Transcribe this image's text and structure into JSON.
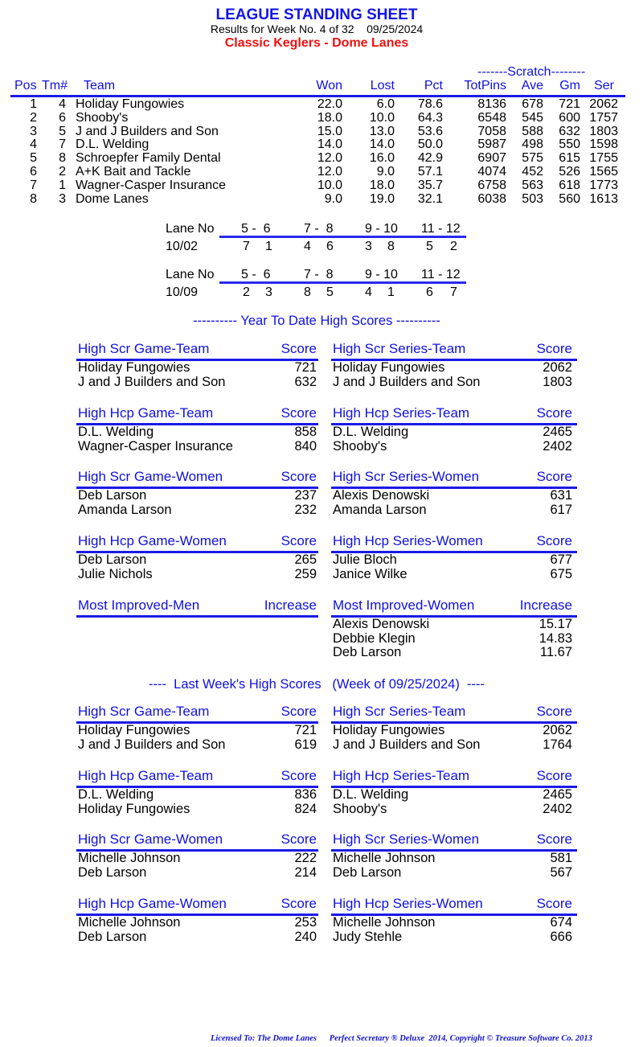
{
  "header": {
    "title": "LEAGUE STANDING SHEET",
    "subtitle": "Results for Week No. 4 of 32    09/25/2024",
    "league": "Classic Keglers - Dome Lanes"
  },
  "standings": {
    "group_label": "-------Scratch--------",
    "columns": [
      "Pos",
      "Tm#",
      "Team",
      "Won",
      "Lost",
      "Pct",
      "TotPins",
      "Ave",
      "Gm",
      "Ser"
    ],
    "rows": [
      {
        "pos": "1",
        "tm": "4",
        "team": "Holiday Fungowies",
        "won": "22.0",
        "lost": "6.0",
        "pct": "78.6",
        "totpins": "8136",
        "ave": "678",
        "gm": "721",
        "ser": "2062"
      },
      {
        "pos": "2",
        "tm": "6",
        "team": "Shooby's",
        "won": "18.0",
        "lost": "10.0",
        "pct": "64.3",
        "totpins": "6548",
        "ave": "545",
        "gm": "600",
        "ser": "1757"
      },
      {
        "pos": "3",
        "tm": "5",
        "team": "J and J Builders and Son",
        "won": "15.0",
        "lost": "13.0",
        "pct": "53.6",
        "totpins": "7058",
        "ave": "588",
        "gm": "632",
        "ser": "1803"
      },
      {
        "pos": "4",
        "tm": "7",
        "team": "D.L. Welding",
        "won": "14.0",
        "lost": "14.0",
        "pct": "50.0",
        "totpins": "5987",
        "ave": "498",
        "gm": "550",
        "ser": "1598"
      },
      {
        "pos": "5",
        "tm": "8",
        "team": "Schroepfer Family Dental",
        "won": "12.0",
        "lost": "16.0",
        "pct": "42.9",
        "totpins": "6907",
        "ave": "575",
        "gm": "615",
        "ser": "1755"
      },
      {
        "pos": "6",
        "tm": "2",
        "team": "A+K Bait and Tackle",
        "won": "12.0",
        "lost": "9.0",
        "pct": "57.1",
        "totpins": "4074",
        "ave": "452",
        "gm": "526",
        "ser": "1565"
      },
      {
        "pos": "7",
        "tm": "1",
        "team": "Wagner-Casper Insurance",
        "won": "10.0",
        "lost": "18.0",
        "pct": "35.7",
        "totpins": "6758",
        "ave": "563",
        "gm": "618",
        "ser": "1773"
      },
      {
        "pos": "8",
        "tm": "3",
        "team": "Dome Lanes",
        "won": "9.0",
        "lost": "19.0",
        "pct": "32.1",
        "totpins": "6038",
        "ave": "503",
        "gm": "560",
        "ser": "1613"
      }
    ]
  },
  "lane_assignments": [
    {
      "label": "Lane No",
      "lanes": [
        "5 -  6",
        "7 -  8",
        "9 - 10",
        "11 - 12"
      ],
      "date": "10/02",
      "pairs": [
        [
          "7",
          "1"
        ],
        [
          "4",
          "6"
        ],
        [
          "3",
          "8"
        ],
        [
          "5",
          "2"
        ]
      ]
    },
    {
      "label": "Lane No",
      "lanes": [
        "5 -  6",
        "7 -  8",
        "9 - 10",
        "11 - 12"
      ],
      "date": "10/09",
      "pairs": [
        [
          "2",
          "3"
        ],
        [
          "8",
          "5"
        ],
        [
          "4",
          "1"
        ],
        [
          "6",
          "7"
        ]
      ]
    }
  ],
  "ytd": {
    "title": "---------- Year To Date High Scores ----------",
    "boxes": [
      {
        "label": "High Scr Game-Team",
        "score_label": "Score",
        "items": [
          {
            "name": "Holiday Fungowies",
            "value": "721"
          },
          {
            "name": "J and J Builders and Son",
            "value": "632"
          }
        ]
      },
      {
        "label": "High Scr Series-Team",
        "score_label": "Score",
        "items": [
          {
            "name": "Holiday Fungowies",
            "value": "2062"
          },
          {
            "name": "J and J Builders and Son",
            "value": "1803"
          }
        ]
      },
      {
        "label": "High Hcp Game-Team",
        "score_label": "Score",
        "items": [
          {
            "name": "D.L. Welding",
            "value": "858"
          },
          {
            "name": "Wagner-Casper Insurance",
            "value": "840"
          }
        ]
      },
      {
        "label": "High Hcp Series-Team",
        "score_label": "Score",
        "items": [
          {
            "name": "D.L. Welding",
            "value": "2465"
          },
          {
            "name": "Shooby's",
            "value": "2402"
          }
        ]
      },
      {
        "label": "High Scr Game-Women",
        "score_label": "Score",
        "items": [
          {
            "name": "Deb Larson",
            "value": "237"
          },
          {
            "name": "Amanda Larson",
            "value": "232"
          }
        ]
      },
      {
        "label": "High Scr Series-Women",
        "score_label": "Score",
        "items": [
          {
            "name": "Alexis Denowski",
            "value": "631"
          },
          {
            "name": "Amanda Larson",
            "value": "617"
          }
        ]
      },
      {
        "label": "High Hcp Game-Women",
        "score_label": "Score",
        "items": [
          {
            "name": "Deb Larson",
            "value": "265"
          },
          {
            "name": "Julie Nichols",
            "value": "259"
          }
        ]
      },
      {
        "label": "High Hcp Series-Women",
        "score_label": "Score",
        "items": [
          {
            "name": "Julie Bloch",
            "value": "677"
          },
          {
            "name": "Janice Wilke",
            "value": "675"
          }
        ]
      },
      {
        "label": "Most Improved-Men",
        "score_label": "Increase",
        "items": []
      },
      {
        "label": "Most Improved-Women",
        "score_label": "Increase",
        "items": [
          {
            "name": "Alexis Denowski",
            "value": "15.17"
          },
          {
            "name": "Debbie Klegin",
            "value": "14.83"
          },
          {
            "name": "Deb Larson",
            "value": "11.67"
          }
        ]
      }
    ]
  },
  "last_week": {
    "title": "----  Last Week's High Scores   (Week of 09/25/2024)  ----",
    "boxes": [
      {
        "label": "High Scr Game-Team",
        "score_label": "Score",
        "items": [
          {
            "name": "Holiday Fungowies",
            "value": "721"
          },
          {
            "name": "J and J Builders and Son",
            "value": "619"
          }
        ]
      },
      {
        "label": "High Scr Series-Team",
        "score_label": "Score",
        "items": [
          {
            "name": "Holiday Fungowies",
            "value": "2062"
          },
          {
            "name": "J and J Builders and Son",
            "value": "1764"
          }
        ]
      },
      {
        "label": "High Hcp Game-Team",
        "score_label": "Score",
        "items": [
          {
            "name": "D.L. Welding",
            "value": "836"
          },
          {
            "name": "Holiday Fungowies",
            "value": "824"
          }
        ]
      },
      {
        "label": "High Hcp Series-Team",
        "score_label": "Score",
        "items": [
          {
            "name": "D.L. Welding",
            "value": "2465"
          },
          {
            "name": "Shooby's",
            "value": "2402"
          }
        ]
      },
      {
        "label": "High Scr Game-Women",
        "score_label": "Score",
        "items": [
          {
            "name": "Michelle Johnson",
            "value": "222"
          },
          {
            "name": "Deb Larson",
            "value": "214"
          }
        ]
      },
      {
        "label": "High Scr Series-Women",
        "score_label": "Score",
        "items": [
          {
            "name": "Michelle Johnson",
            "value": "581"
          },
          {
            "name": "Deb Larson",
            "value": "567"
          }
        ]
      },
      {
        "label": "High Hcp Game-Women",
        "score_label": "Score",
        "items": [
          {
            "name": "Michelle Johnson",
            "value": "253"
          },
          {
            "name": "Deb Larson",
            "value": "240"
          }
        ]
      },
      {
        "label": "High Hcp Series-Women",
        "score_label": "Score",
        "items": [
          {
            "name": "Michelle Johnson",
            "value": "674"
          },
          {
            "name": "Judy Stehle",
            "value": "666"
          }
        ]
      }
    ]
  },
  "footer": {
    "text": "Licensed To: The Dome Lanes      Perfect Secretary ® Deluxe  2014, Copyright © Treasure Software Co. 2013"
  },
  "colors": {
    "heading_blue": "#1010e0",
    "rule_blue": "#1a1ae6",
    "league_red": "#ee1111"
  }
}
